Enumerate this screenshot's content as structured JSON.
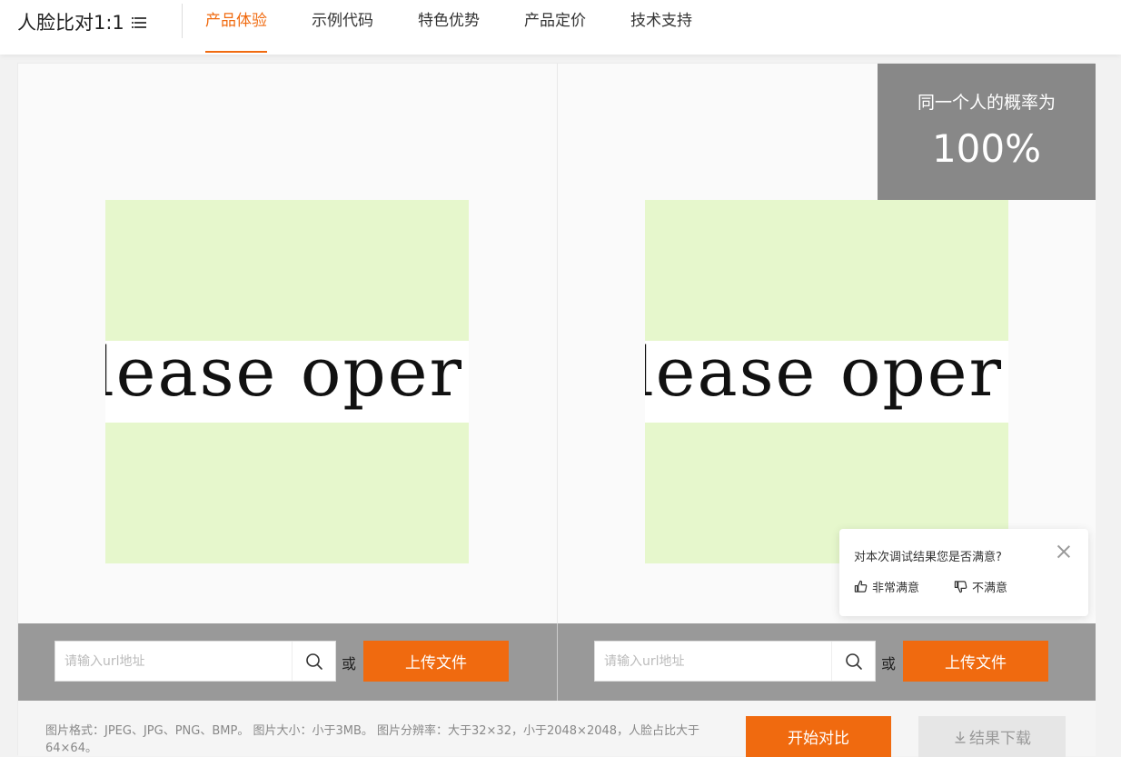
{
  "header": {
    "brand": "人脸比对1:1",
    "menu_icon": "list-menu-icon",
    "tabs": [
      {
        "label": "产品体验",
        "active": true
      },
      {
        "label": "示例代码",
        "active": false
      },
      {
        "label": "特色优势",
        "active": false
      },
      {
        "label": "产品定价",
        "active": false
      },
      {
        "label": "技术支持",
        "active": false
      }
    ]
  },
  "images": {
    "left_text": "lease oper",
    "right_text": "lease oper"
  },
  "result": {
    "label": "同一个人的概率为",
    "value": "100%"
  },
  "feedback": {
    "question": "对本次调试结果您是否满意?",
    "satisfied": "非常满意",
    "unsatisfied": "不满意",
    "close_icon": "close-icon"
  },
  "upload": {
    "left": {
      "placeholder": "请输入url地址",
      "value": "",
      "or": "或",
      "button": "上传文件"
    },
    "right": {
      "placeholder": "请输入url地址",
      "value": "",
      "or": "或",
      "button": "上传文件"
    }
  },
  "footer": {
    "note": "图片格式：JPEG、JPG、PNG、BMP。 图片大小：小于3MB。 图片分辨率：大于32×32，小于2048×2048，人脸占比大于64×64。",
    "start_button": "开始对比",
    "download_button": "结果下载"
  },
  "colors": {
    "accent": "#f06a0f",
    "image_bg": "#e6f7cc",
    "result_bg": "#888888",
    "upload_bar_bg": "#999999"
  }
}
